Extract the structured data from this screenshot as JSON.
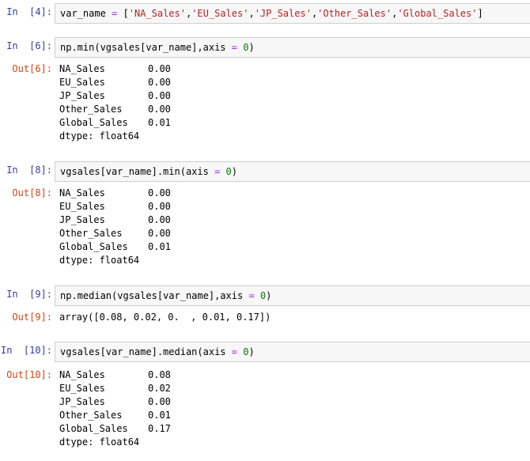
{
  "cells": [
    {
      "in_prompt": "In  [4]:",
      "code": [
        {
          "t": "var_name ",
          "c": ""
        },
        {
          "t": "=",
          "c": "op"
        },
        {
          "t": " [",
          "c": ""
        },
        {
          "t": "'NA_Sales'",
          "c": "str"
        },
        {
          "t": ",",
          "c": ""
        },
        {
          "t": "'EU_Sales'",
          "c": "str"
        },
        {
          "t": ",",
          "c": ""
        },
        {
          "t": "'JP_Sales'",
          "c": "str"
        },
        {
          "t": ",",
          "c": ""
        },
        {
          "t": "'Other_Sales'",
          "c": "str"
        },
        {
          "t": ",",
          "c": ""
        },
        {
          "t": "'Global_Sales'",
          "c": "str"
        },
        {
          "t": "]",
          "c": ""
        }
      ]
    },
    {
      "in_prompt": "In  [6]:",
      "code": [
        {
          "t": "np.min(vgsales[var_name],axis ",
          "c": ""
        },
        {
          "t": "=",
          "c": "op"
        },
        {
          "t": " ",
          "c": ""
        },
        {
          "t": "0",
          "c": "num"
        },
        {
          "t": ")",
          "c": ""
        }
      ],
      "out_prompt": "Out[6]:",
      "series": [
        {
          "k": "NA_Sales",
          "v": "0.00"
        },
        {
          "k": "EU_Sales",
          "v": "0.00"
        },
        {
          "k": "JP_Sales",
          "v": "0.00"
        },
        {
          "k": "Other_Sales",
          "v": "0.00"
        },
        {
          "k": "Global_Sales",
          "v": "0.01"
        }
      ],
      "dtype": "dtype: float64"
    },
    {
      "in_prompt": "In  [8]:",
      "code": [
        {
          "t": "vgsales[var_name].min(axis ",
          "c": ""
        },
        {
          "t": "=",
          "c": "op"
        },
        {
          "t": " ",
          "c": ""
        },
        {
          "t": "0",
          "c": "num"
        },
        {
          "t": ")",
          "c": ""
        }
      ],
      "out_prompt": "Out[8]:",
      "series": [
        {
          "k": "NA_Sales",
          "v": "0.00"
        },
        {
          "k": "EU_Sales",
          "v": "0.00"
        },
        {
          "k": "JP_Sales",
          "v": "0.00"
        },
        {
          "k": "Other_Sales",
          "v": "0.00"
        },
        {
          "k": "Global_Sales",
          "v": "0.01"
        }
      ],
      "dtype": "dtype: float64"
    },
    {
      "in_prompt": "In  [9]:",
      "code": [
        {
          "t": "np.median(vgsales[var_name],axis ",
          "c": ""
        },
        {
          "t": "=",
          "c": "op"
        },
        {
          "t": " ",
          "c": ""
        },
        {
          "t": "0",
          "c": "num"
        },
        {
          "t": ")",
          "c": ""
        }
      ],
      "out_prompt": "Out[9]:",
      "plain": "array([0.08, 0.02, 0.  , 0.01, 0.17])"
    },
    {
      "in_prompt": "In  [10]:",
      "code": [
        {
          "t": "vgsales[var_name].median(axis ",
          "c": ""
        },
        {
          "t": "=",
          "c": "op"
        },
        {
          "t": " ",
          "c": ""
        },
        {
          "t": "0",
          "c": "num"
        },
        {
          "t": ")",
          "c": ""
        }
      ],
      "out_prompt": "Out[10]:",
      "series": [
        {
          "k": "NA_Sales",
          "v": "0.08"
        },
        {
          "k": "EU_Sales",
          "v": "0.02"
        },
        {
          "k": "JP_Sales",
          "v": "0.00"
        },
        {
          "k": "Other_Sales",
          "v": "0.01"
        },
        {
          "k": "Global_Sales",
          "v": "0.17"
        }
      ],
      "dtype": "dtype: float64"
    }
  ]
}
